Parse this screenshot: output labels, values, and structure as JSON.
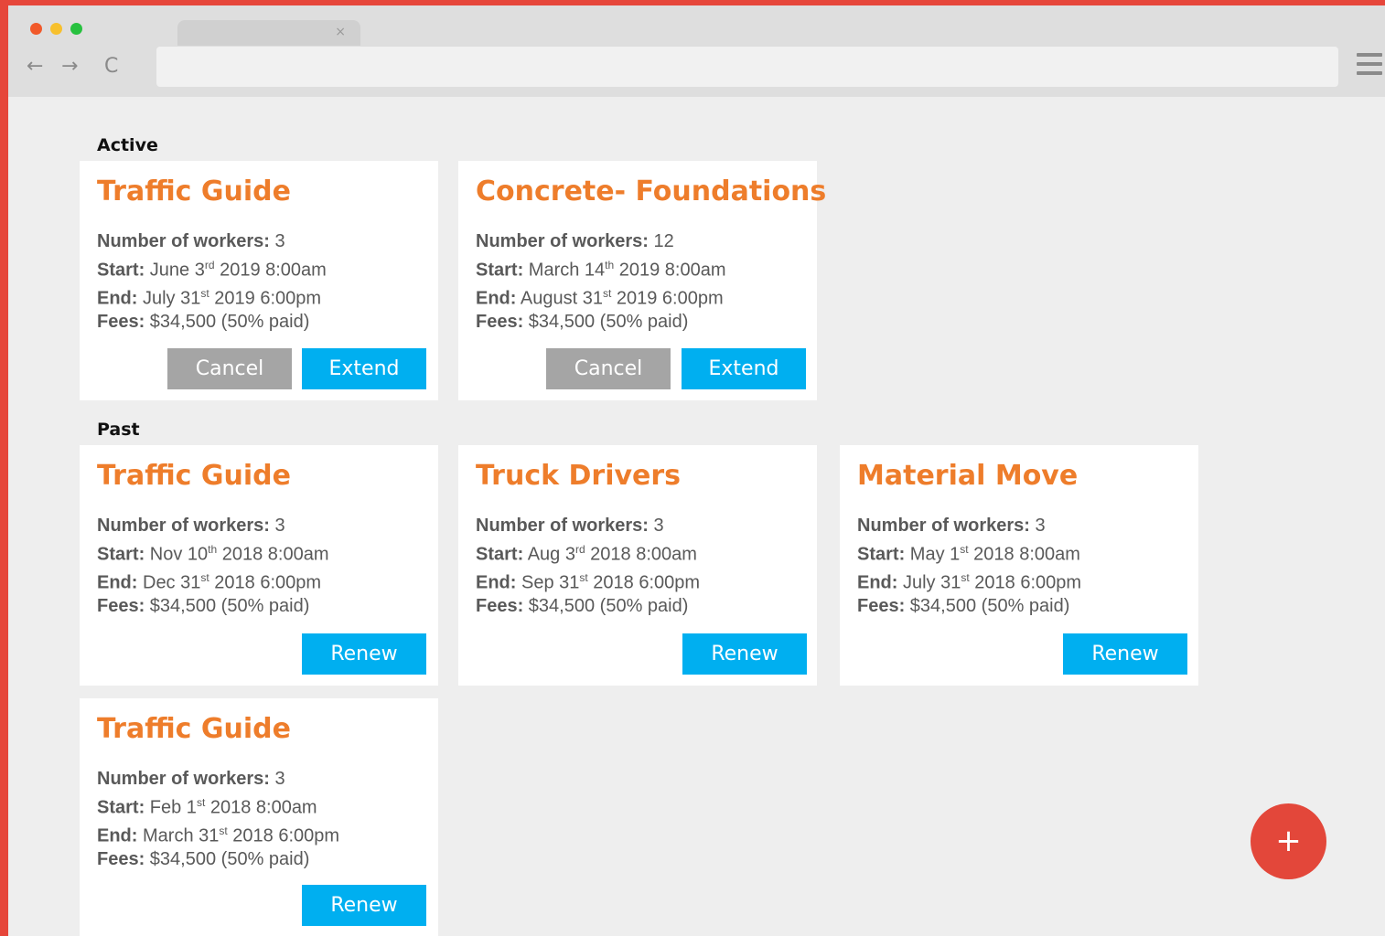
{
  "browser": {
    "tab_close": "×",
    "nav_back": "←",
    "nav_forward": "→",
    "nav_reload": "C",
    "url": ""
  },
  "sections": {
    "active_label": "Active",
    "past_label": "Past"
  },
  "active": [
    {
      "title": "Traffic Guide",
      "workers_label": "Number of workers:",
      "workers": " 3",
      "start_label": "Start:",
      "start_pre": " June 3",
      "start_sup": "rd",
      "start_post": " 2019 8:00am",
      "end_label": "End:",
      "end_pre": " July 31",
      "end_sup": "st",
      "end_post": " 2019 6:00pm",
      "fees_label": "Fees:",
      "fees": " $34,500 (50% paid)",
      "cancel": "Cancel",
      "extend": "Extend"
    },
    {
      "title": "Concrete- Foundations",
      "workers_label": "Number of workers:",
      "workers": " 12",
      "start_label": "Start:",
      "start_pre": " March 14",
      "start_sup": "th",
      "start_post": " 2019 8:00am",
      "end_label": "End:",
      "end_pre": " August 31",
      "end_sup": "st",
      "end_post": " 2019 6:00pm",
      "fees_label": "Fees:",
      "fees": " $34,500 (50% paid)",
      "cancel": "Cancel",
      "extend": "Extend"
    }
  ],
  "past": [
    {
      "title": "Traffic Guide",
      "workers_label": "Number of workers:",
      "workers": " 3",
      "start_label": "Start:",
      "start_pre": " Nov 10",
      "start_sup": "th",
      "start_post": " 2018 8:00am",
      "end_label": "End:",
      "end_pre": " Dec 31",
      "end_sup": "st",
      "end_post": " 2018 6:00pm",
      "fees_label": "Fees:",
      "fees": " $34,500 (50% paid)",
      "renew": "Renew"
    },
    {
      "title": "Truck Drivers",
      "workers_label": "Number of workers:",
      "workers": " 3",
      "start_label": "Start:",
      "start_pre": " Aug 3",
      "start_sup": "rd",
      "start_post": " 2018 8:00am",
      "end_label": "End:",
      "end_pre": " Sep 31",
      "end_sup": "st",
      "end_post": " 2018 6:00pm",
      "fees_label": "Fees:",
      "fees": " $34,500 (50% paid)",
      "renew": "Renew"
    },
    {
      "title": "Material Move",
      "workers_label": "Number of workers:",
      "workers": " 3",
      "start_label": "Start:",
      "start_pre": " May 1",
      "start_sup": "st",
      "start_post": " 2018 8:00am",
      "end_label": "End:",
      "end_pre": " July 31",
      "end_sup": "st",
      "end_post": " 2018 6:00pm",
      "fees_label": "Fees:",
      "fees": " $34,500 (50% paid)",
      "renew": "Renew"
    },
    {
      "title": "Traffic Guide",
      "workers_label": "Number of workers:",
      "workers": " 3",
      "start_label": "Start:",
      "start_pre": " Feb 1",
      "start_sup": "st",
      "start_post": " 2018 8:00am",
      "end_label": "End:",
      "end_pre": " March 31",
      "end_sup": "st",
      "end_post": " 2018 6:00pm",
      "fees_label": "Fees:",
      "fees": " $34,500 (50% paid)",
      "renew": "Renew"
    }
  ],
  "fab": {
    "label": "+"
  },
  "colors": {
    "frame": "#e6463a",
    "title_orange": "#ee7d2b",
    "primary_blue": "#00aff0",
    "cancel_gray": "#a5a5a5",
    "fab_red": "#e3473a"
  },
  "icons": [
    "close-icon",
    "back-arrow-icon",
    "forward-arrow-icon",
    "reload-icon",
    "hamburger-menu-icon",
    "plus-icon"
  ]
}
